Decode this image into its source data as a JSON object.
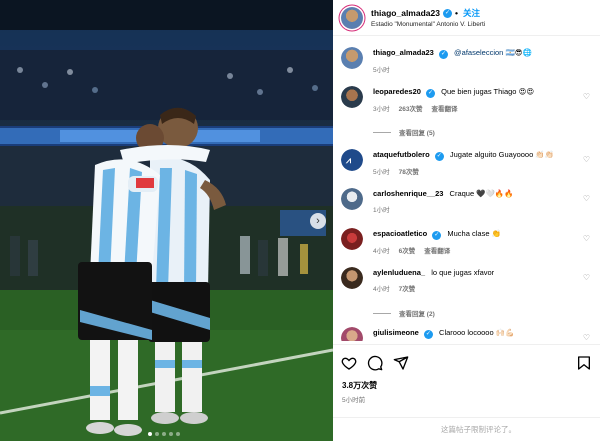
{
  "post": {
    "author": "thiago_almada23",
    "location": "Estadio \"Monumental\" Antonio V. Liberti",
    "follow_label": "关注",
    "separator": "•"
  },
  "caption": {
    "user": "thiago_almada23",
    "text": "@afaseleccion",
    "emoji": "🇦🇷😎🌐",
    "time": "5小时"
  },
  "comments": [
    {
      "user": "leoparedes20",
      "text": "Que bien jugas Thiago",
      "emoji": "😍😍",
      "time": "3小时",
      "likes": "263次赞",
      "reply": "查看翻译",
      "verified": true,
      "replies": "查看回复 (5)"
    },
    {
      "user": "ataquefutbolero",
      "text": "Jugate alguito Guayoooo",
      "emoji": "👏🏻👏🏻",
      "time": "5小时",
      "likes": "78次赞",
      "reply": "",
      "verified": true
    },
    {
      "user": "carloshenrique__23",
      "text": "Craque",
      "emoji": "🖤🤍🔥🔥",
      "time": "1小时",
      "likes": "",
      "reply": "",
      "verified": false
    },
    {
      "user": "espacioatletico",
      "text": "Mucha clase",
      "emoji": "👏",
      "time": "4小时",
      "likes": "6次赞",
      "reply": "查看翻译",
      "verified": true
    },
    {
      "user": "aylenluduena_",
      "text": "lo que jugas xfavor",
      "emoji": "",
      "time": "4小时",
      "likes": "7次赞",
      "reply": "",
      "verified": false,
      "replies": "查看回复 (2)"
    },
    {
      "user": "giulisimeone",
      "text": "Clarooo locoooo",
      "emoji": "🙌🏻💪🏻",
      "time": "",
      "likes": "",
      "reply": "",
      "verified": true
    }
  ],
  "footer": {
    "likes": "3.8万次赞",
    "time": "5小时前",
    "comment_placeholder": "这篇帖子限制评论了。"
  },
  "icons": {
    "like": "heart-icon",
    "comment": "comment-icon",
    "share": "share-icon",
    "save": "bookmark-icon",
    "next": "chevron-right-icon",
    "verified": "verified-badge-icon"
  },
  "colors": {
    "link_blue": "#0095f6",
    "verified_blue": "#1d9bf0",
    "meta_gray": "#737373",
    "jersey_blue": "#6cb4e4"
  }
}
